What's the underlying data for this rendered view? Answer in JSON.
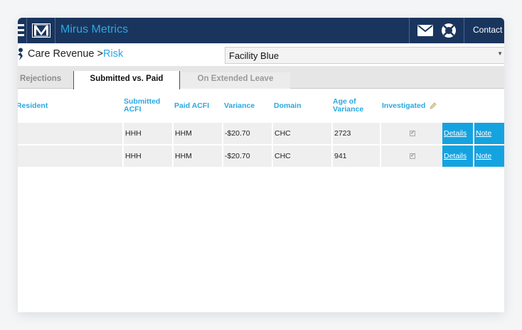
{
  "app": {
    "title": "Mirus Metrics",
    "logo_text": "M"
  },
  "topbar": {
    "contact_label": "Contact"
  },
  "breadcrumb": {
    "section": "Care Revenue",
    "separator": ">",
    "current": "Risk"
  },
  "facility": {
    "selected": "Facility Blue"
  },
  "tabs": [
    {
      "label": "Rejections"
    },
    {
      "label": "Submitted vs. Paid"
    },
    {
      "label": "On Extended Leave"
    }
  ],
  "table": {
    "headers": {
      "resident": "Resident",
      "submitted_acfi": "Submitted ACFI",
      "paid_acfi": "Paid ACFI",
      "variance": "Variance",
      "domain": "Domain",
      "age_of_variance": "Age of Variance",
      "investigated": "Investigated"
    },
    "rows": [
      {
        "resident": "",
        "submitted": "HHH",
        "paid": "HHM",
        "variance": "-$20.70",
        "domain": "CHC",
        "age": "2723",
        "investigated": true,
        "details": "Details",
        "note": "Note"
      },
      {
        "resident": "",
        "submitted": "HHH",
        "paid": "HHM",
        "variance": "-$20.70",
        "domain": "CHC",
        "age": "941",
        "investigated": true,
        "details": "Details",
        "note": "Note"
      }
    ]
  },
  "colors": {
    "navy": "#19355e",
    "accent": "#29a8e0",
    "action": "#15a3e0"
  }
}
